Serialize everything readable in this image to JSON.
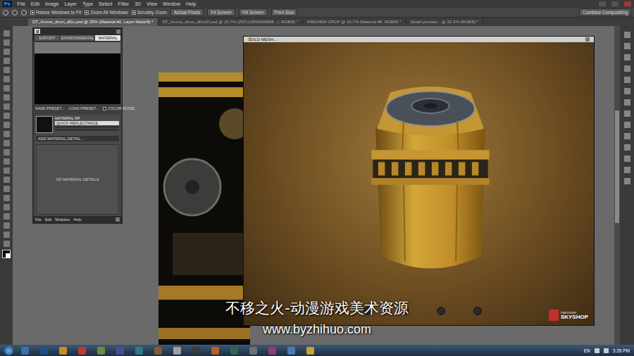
{
  "app": {
    "logo": "Ps"
  },
  "menu": [
    "File",
    "Edit",
    "Image",
    "Layer",
    "Type",
    "Select",
    "Filter",
    "3D",
    "View",
    "Window",
    "Help"
  ],
  "options": {
    "checkboxes": [
      {
        "label": "Resize Windows to Fit",
        "checked": true
      },
      {
        "label": "Zoom All Windows",
        "checked": true
      },
      {
        "label": "Scrubby Zoom",
        "checked": true
      }
    ],
    "buttons": [
      "Actual Pixels",
      "Fit Screen",
      "Fill Screen",
      "Print Size"
    ],
    "workspace": "Combine Compositing"
  },
  "tabs": [
    {
      "label": "DT_Ammo_drum_dDo.psd @ 25% (Material #2, Layer Mask/8) *",
      "selected": true
    },
    {
      "label": "DT_Ammo_drum_dDo02.psd @ 16.7% (ZSF(13816545868...), RGB/8) *",
      "selected": false
    },
    {
      "label": "PREVIEW CROP @ 16.7% (Material #8, RGB/8) *",
      "selected": false
    },
    {
      "label": "Detail preview... @ 33.3% (RGB/8) *",
      "selected": false
    }
  ],
  "skyshop": {
    "logo": "d",
    "tabs": [
      {
        "label": "EXPORT",
        "selected": false
      },
      {
        "label": "ENVIRONMENTAL",
        "selected": false
      },
      {
        "label": "MATERIAL",
        "selected": true
      }
    ],
    "actions": [
      "SAVE PRESET...",
      "LOAD PRESET..."
    ],
    "color_mode": {
      "label": "COLOR MODE",
      "checked": false
    },
    "material": {
      "title": "MATERIAL RF",
      "preset": "QUICK-REFLECTANCE",
      "add": "ADD MATERIAL DETAIL...",
      "empty": "NO MATERIAL DETAILS"
    },
    "menu": [
      "File",
      "Edit",
      "Modules",
      "Help"
    ]
  },
  "viewport": {
    "title": "3D/LD MESH...",
    "brand": {
      "small": "marmoset",
      "name": "SKYSHOP"
    }
  },
  "watermark": {
    "title": "不移之火-动漫游戏美术资源",
    "url": "www.byzhihuo.com"
  },
  "taskbar": {
    "language": "EN",
    "time": "3:26 PM"
  }
}
